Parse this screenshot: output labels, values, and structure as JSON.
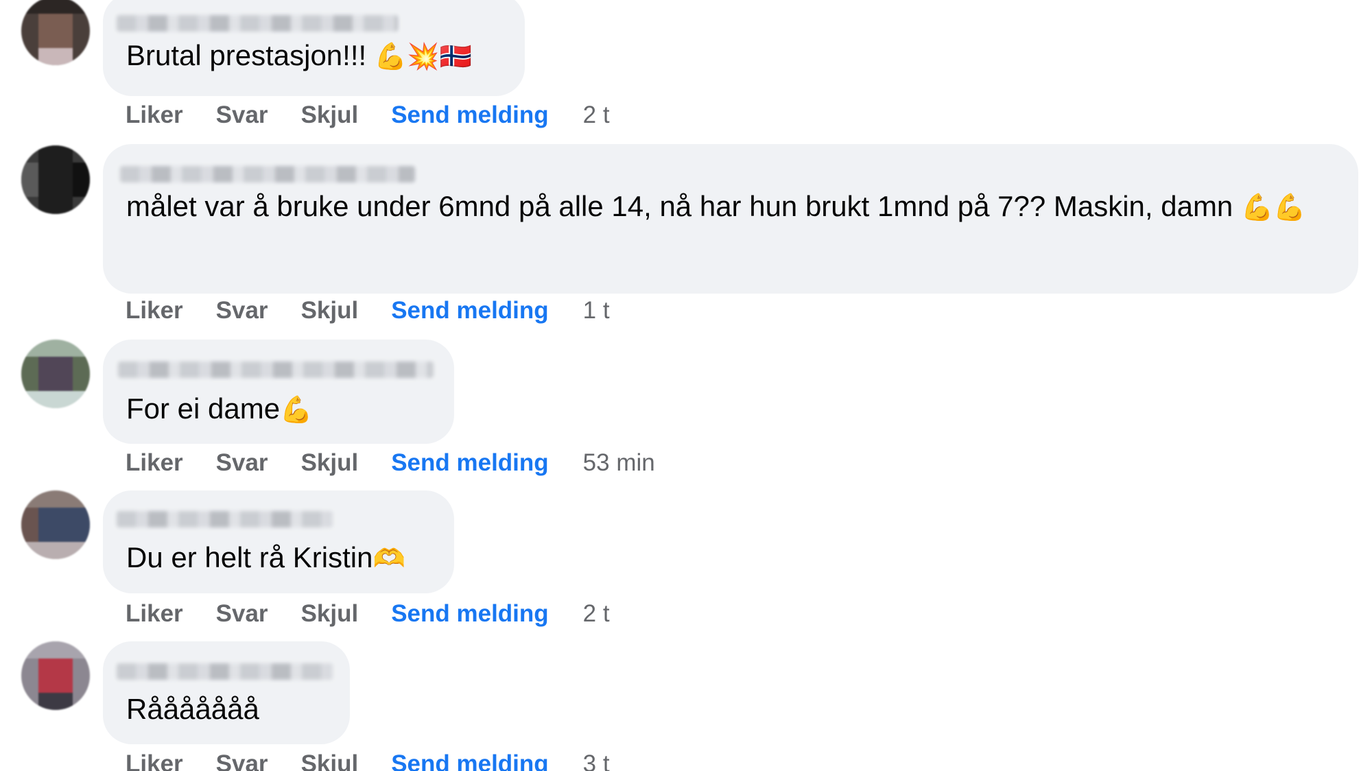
{
  "actions": {
    "like": "Liker",
    "reply": "Svar",
    "hide": "Skjul",
    "send_message": "Send melding"
  },
  "comments": [
    {
      "text": "Brutal prestasjon!!!",
      "emoji": "💪💥🇳🇴",
      "time": "2 t"
    },
    {
      "text": "målet var å bruke under 6mnd på alle 14, nå har hun brukt 1mnd på 7?? Maskin, damn",
      "emoji": "💪💪",
      "time": "1 t"
    },
    {
      "text": "For ei dame",
      "emoji": "💪",
      "time": "53 min"
    },
    {
      "text": "Du er helt rå Kristin",
      "emoji": "🫶",
      "time": "2 t"
    },
    {
      "text": "Rååååååå",
      "emoji": "",
      "time": "3 t"
    }
  ],
  "colors": {
    "bubble": "#f0f2f5",
    "link_blue": "#1877f2",
    "muted": "#65676b"
  }
}
